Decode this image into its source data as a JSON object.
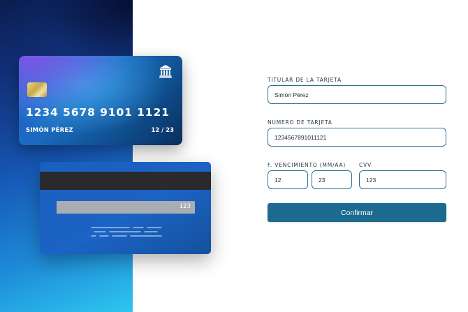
{
  "card_front": {
    "number": "1234 5678 9101 1121",
    "holder": "SIMÓN PÉREZ",
    "expiry": "12 / 23",
    "bank_icon": "bank-icon"
  },
  "card_back": {
    "cvv": "123"
  },
  "form": {
    "holder_label": "TITULAR DE LA TARJETA",
    "holder_value": "Simón Pérez",
    "number_label": "NUMERO DE TARJETA",
    "number_value": "1234567891011121",
    "expiry_label": "F. VENCIMIENTO (MM/AA)",
    "expiry_month_value": "12",
    "expiry_year_value": "23",
    "cvv_label": "CVV",
    "cvv_value": "123",
    "confirm_label": "Confirmar"
  },
  "colors": {
    "accent": "#1c6a8f",
    "field_border": "#2e6f8f"
  }
}
